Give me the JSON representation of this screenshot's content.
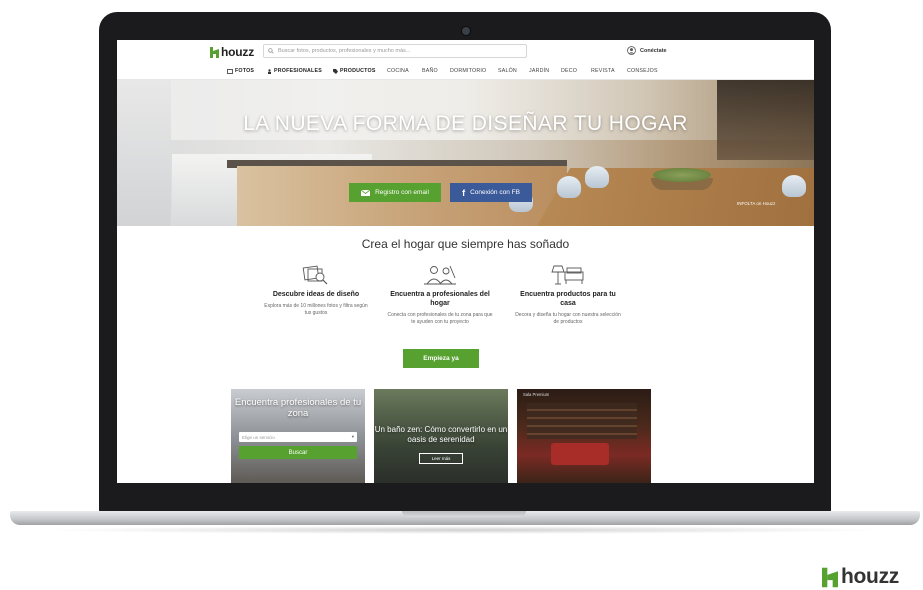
{
  "brand": {
    "name": "houzz",
    "color": "#56a12f"
  },
  "header": {
    "search_placeholder": "Buscar fotos, productos, profesionales y mucho más...",
    "signin_label": "Conéctate"
  },
  "nav": {
    "items": [
      {
        "label": "FOTOS",
        "icon": "photo-icon"
      },
      {
        "label": "PROFESIONALES",
        "icon": "person-icon"
      },
      {
        "label": "PRODUCTOS",
        "icon": "tag-icon"
      },
      {
        "label": "COCINA"
      },
      {
        "label": "BAÑO"
      },
      {
        "label": "DORMITORIO"
      },
      {
        "label": "SALÓN"
      },
      {
        "label": "JARDÍN"
      },
      {
        "label": "DECO"
      },
      {
        "label": "REVISTA"
      },
      {
        "label": "CONSEJOS"
      }
    ]
  },
  "hero": {
    "title": "LA NUEVA FORMA DE DISEÑAR TU HOGAR",
    "email_button": "Registro con email",
    "fb_button": "Conexión con FB",
    "credit": "INFOLTA on Houzz"
  },
  "main": {
    "tagline": "Crea el hogar que siempre has soñado",
    "features": [
      {
        "title": "Descubre ideas de diseño",
        "desc": "Explora más de 10 millones fotos y filtra según tus gustos",
        "icon": "photos-magnifier-icon"
      },
      {
        "title": "Encuentra a profesionales del hogar",
        "desc": "Conecta con profesionales de tu zona para que te ayuden con tu proyecto",
        "icon": "professionals-icon"
      },
      {
        "title": "Encuentra productos para tu casa",
        "desc": "Decora y diseña tu hogar con nuestra selección de productos",
        "icon": "furniture-icon"
      }
    ],
    "cta": "Empieza ya"
  },
  "cards": {
    "pros": {
      "title": "Encuentra profesionales de tu zona",
      "select_placeholder": "Elige un servicio",
      "button": "Buscar"
    },
    "article": {
      "title": "Un baño zen: Cómo convertirlo en un oasis de serenidad",
      "button": "Leer más"
    },
    "photo": {
      "label": "Sala Premium"
    }
  }
}
